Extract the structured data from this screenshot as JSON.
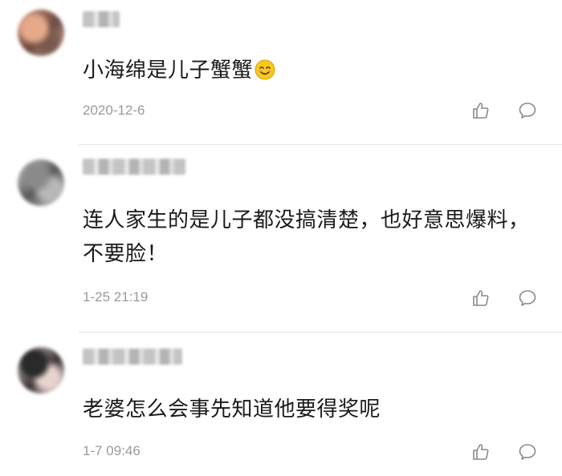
{
  "comments": [
    {
      "text": "小海绵是儿子蟹蟹",
      "emoji": "smiling-face-icon",
      "date": "2020-12-6"
    },
    {
      "text": "连人家生的是儿子都没搞清楚，也好意思爆料，不要脸！",
      "date": "1-25 21:19"
    },
    {
      "text": "老婆怎么会事先知道他要得奖呢",
      "date": "1-7 09:46"
    }
  ],
  "colors": {
    "text": "#1a1a1a",
    "meta": "#9a9a9a",
    "icon": "#8a8a8a",
    "divider": "#e6e6e6",
    "emoji": "#f5c518"
  }
}
